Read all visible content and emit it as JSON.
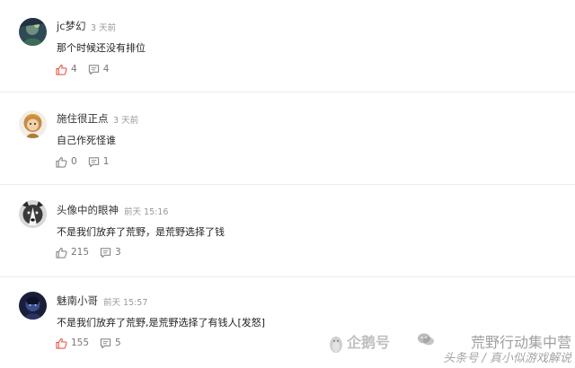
{
  "comments": [
    {
      "username": "jc梦幻",
      "time": "3 天前",
      "content": "那个时候还没有排位",
      "likes": "4",
      "replies": "4",
      "liked": true
    },
    {
      "username": "施住很正点",
      "time": "3 天前",
      "content": "自己作死怪谁",
      "likes": "0",
      "replies": "1",
      "liked": false
    },
    {
      "username": "头像中的眼神",
      "time": "前天 15:16",
      "content": "不是我们放弃了荒野，是荒野选择了钱",
      "likes": "215",
      "replies": "3",
      "liked": false
    },
    {
      "username": "魅南小哥",
      "time": "前天 15:57",
      "content": "不是我们放弃了荒野,是荒野选择了有钱人[发怒]",
      "likes": "155",
      "replies": "5",
      "liked": true
    }
  ],
  "watermark": {
    "brand": "企鹅号",
    "account": "荒野行动集中营",
    "byline": "头条号 / 真小似游戏解说"
  },
  "colors": {
    "liked": "#e8594f",
    "neutral": "#888888",
    "divider": "#ececec"
  },
  "icons": {
    "like": "thumbs-up-icon",
    "reply": "comment-icon"
  }
}
